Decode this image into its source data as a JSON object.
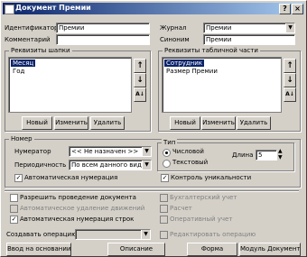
{
  "window": {
    "title": "Документ Премии",
    "buttons": [
      "?",
      "×"
    ]
  },
  "header": {
    "identifier_label": "Идентификатор",
    "identifier_value": "Премии",
    "comment_label": "Комментарий",
    "comment_value": "",
    "journal_label": "Журнал",
    "journal_value": "Премии",
    "synonym_label": "Синоним",
    "synonym_value": "Премии"
  },
  "header_attrs": {
    "label": "Реквизиты шапки",
    "items": [
      "Месяц",
      "Год"
    ],
    "selected": 0,
    "buttons": {
      "new": "Новый",
      "edit": "Изменить",
      "delete": "Удалить"
    }
  },
  "table_attrs": {
    "label": "Реквизиты табличной части",
    "items": [
      "Сотрудник",
      "Размер Премии"
    ],
    "selected": 0,
    "buttons": {
      "new": "Новый",
      "edit": "Изменить",
      "delete": "Удалить"
    }
  },
  "number": {
    "group_label": "Номер",
    "numerator_label": "Нумератор",
    "numerator_value": "<< Не назначен >>",
    "periodicity_label": "Периодичность",
    "periodicity_value": "По всем данного вида",
    "type_label": "Тип",
    "type_numeric": "Числовой",
    "type_text": "Текстовый",
    "length_label": "Длина",
    "length_value": "5",
    "auto_numbering": "Автоматическая нумерация",
    "uniqueness_control": "Контроль уникальности"
  },
  "options": {
    "allow_posting": "Разрешить проведение документа",
    "auto_delete_unposted": "Автоматическое удаление движений",
    "auto_row_numbering": "Автоматическая нумерация строк",
    "accounting": "Бухгалтерский учет",
    "calculation": "Расчет",
    "operational": "Оперативный учет"
  },
  "create_operation": {
    "label": "Создавать операцию:",
    "value": "",
    "edit_operation": "Редактировать операцию"
  },
  "footer": {
    "input_based_on": "Ввод на основании...",
    "description": "Описание",
    "form": "Форма",
    "module": "Модуль Документа"
  }
}
